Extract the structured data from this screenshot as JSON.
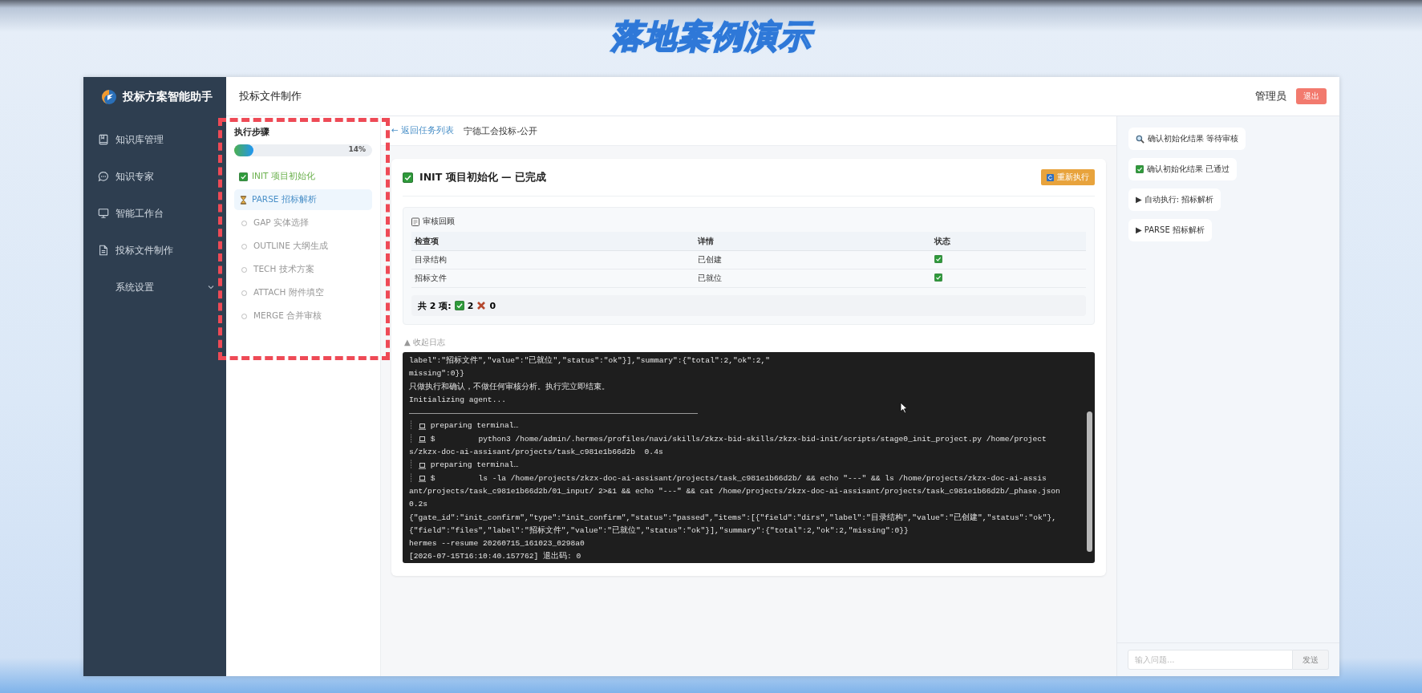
{
  "slide_title": "落地案例演示",
  "app": {
    "name": "投标方案智能助手"
  },
  "nav": [
    {
      "label": "知识库管理",
      "kind": "book"
    },
    {
      "label": "知识专家",
      "kind": "chat"
    },
    {
      "label": "智能工作台",
      "kind": "monitor"
    },
    {
      "label": "投标文件制作",
      "kind": "doc"
    },
    {
      "label": "系统设置",
      "kind": "group",
      "expanded": false
    }
  ],
  "header": {
    "title": "投标文件制作",
    "user": "管理员",
    "logout": "退出"
  },
  "steps": {
    "title": "执行步骤",
    "progress": {
      "level": 0.14,
      "reading": "14%"
    },
    "items": [
      {
        "label": "INIT 项目初始化",
        "kind": "done"
      },
      {
        "label": "PARSE 招标解析",
        "kind": "running"
      },
      {
        "label": "GAP 实体选择",
        "kind": "pending"
      },
      {
        "label": "OUTLINE 大纲生成",
        "kind": "pending"
      },
      {
        "label": "TECH 技术方案",
        "kind": "pending"
      },
      {
        "label": "ATTACH 附件填空",
        "kind": "pending"
      },
      {
        "label": "MERGE 合并审核",
        "kind": "pending"
      }
    ]
  },
  "breadcrumb": {
    "back": "← 返回任务列表",
    "title": "宁德工会投标-公开"
  },
  "stage": {
    "title": "INIT 项目初始化 — 已完成",
    "rerun": "重新执行",
    "review": {
      "title": "审核回顾",
      "columns": [
        "检查项",
        "详情",
        "状态"
      ],
      "rows": [
        {
          "item": "目录结构",
          "detail": "已创建",
          "passed": true
        },
        {
          "item": "招标文件",
          "detail": "已就位",
          "passed": true
        }
      ],
      "summary": {
        "label": "共 2 项:",
        "ok": "2",
        "failed": "0"
      }
    },
    "log_toggle": "▲ 收起日志",
    "log": [
      {
        "kind": "text",
        "text": "label\":\"招标文件\",\"value\":\"已就位\",\"status\":\"ok\"}],\"summary\":{\"total\":2,\"ok\":2,\""
      },
      {
        "kind": "text",
        "text": "missing\":0}}"
      },
      {
        "kind": "text",
        "text": "只做执行和确认，不做任何审核分析。执行完立即结束。"
      },
      {
        "kind": "text",
        "text": "Initializing agent..."
      },
      {
        "kind": "rule"
      },
      {
        "kind": "tool",
        "gutter": "┊",
        "text": "preparing terminal…"
      },
      {
        "kind": "command",
        "gutter": "┊",
        "prompt": "$",
        "text": "python3 /home/admin/.hermes/profiles/navi/skills/zkzx-bid-skills/zkzx-bid-init/scripts/stage0_init_project.py /home/project"
      },
      {
        "kind": "text",
        "text": "s/zkzx-doc-ai-assisant/projects/task_c981e1b66d2b  0.4s"
      },
      {
        "kind": "tool",
        "gutter": "┊",
        "text": "preparing terminal…"
      },
      {
        "kind": "command",
        "gutter": "┊",
        "prompt": "$",
        "text": "ls -la /home/projects/zkzx-doc-ai-assisant/projects/task_c981e1b66d2b/ && echo \"---\" && ls /home/projects/zkzx-doc-ai-assis"
      },
      {
        "kind": "text",
        "text": "ant/projects/task_c981e1b66d2b/01_input/ 2>&1 && echo \"---\" && cat /home/projects/zkzx-doc-ai-assisant/projects/task_c981e1b66d2b/_phase.json"
      },
      {
        "kind": "text",
        "text": "0.2s"
      },
      {
        "kind": "text",
        "text": "{\"gate_id\":\"init_confirm\",\"type\":\"init_confirm\",\"status\":\"passed\",\"items\":[{\"field\":\"dirs\",\"label\":\"目录结构\",\"value\":\"已创建\",\"status\":\"ok\"},"
      },
      {
        "kind": "text",
        "text": "{\"field\":\"files\",\"label\":\"招标文件\",\"value\":\"已就位\",\"status\":\"ok\"}],\"summary\":{\"total\":2,\"ok\":2,\"missing\":0}}"
      },
      {
        "kind": "text",
        "text": "hermes --resume 20260715_161023_0298a0"
      },
      {
        "kind": "text",
        "text": "[2026-07-15T16:10:40.157762] 退出码: 0"
      }
    ]
  },
  "chat": {
    "messages": [
      {
        "kind": "search",
        "text": "确认初始化结果 等待审核"
      },
      {
        "kind": "check",
        "text": "确认初始化结果 已通过"
      },
      {
        "kind": "plain",
        "text": "▶ 自动执行: 招标解析"
      },
      {
        "kind": "plain",
        "text": "▶ PARSE 招标解析"
      }
    ],
    "input_placeholder": "输入问题...",
    "send": "发送"
  }
}
